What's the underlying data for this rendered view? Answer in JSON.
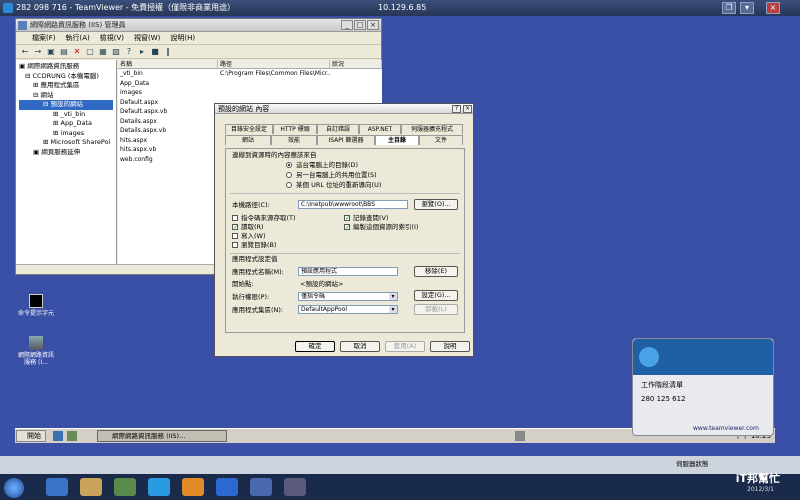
{
  "teamviewer": {
    "title": "282 098 716 - TeamViewer - 免費授權（僅限非商業用途）",
    "remote_ip": "10.129.6.85",
    "buttons": [
      "❐",
      "▾",
      "×"
    ],
    "panel_title": "工作階段清單",
    "panel_id": "280 125 612",
    "panel_link": "www.teamviewer.com",
    "sidebar_status": "伺服器狀態"
  },
  "iis": {
    "title": "網際網路資訊服務 (IIS) 管理員",
    "menu": [
      "檔案(F)",
      "執行(A)",
      "檢視(V)",
      "視窗(W)",
      "說明(H)"
    ],
    "toolbar": [
      "←",
      "→",
      "▣",
      "▤",
      "✕",
      "▢",
      "▦",
      "▧",
      "?",
      "▸",
      "■",
      "‖"
    ],
    "tree": [
      "網際網路資訊服務",
      "CCDRUNG (本機電腦)",
      "應用程式集區",
      "網站",
      "預設的網站",
      "_vti_bin",
      "App_Data",
      "images",
      "Microsoft SharePoi",
      "網頁服務延伸"
    ],
    "columns": [
      "名稱",
      "路徑",
      "狀況"
    ],
    "rows": [
      {
        "name": "_vti_bin",
        "path": "C:\\Program Files\\Common Files\\Micr..."
      },
      {
        "name": "App_Data",
        "path": ""
      },
      {
        "name": "images",
        "path": ""
      },
      {
        "name": "Default.aspx",
        "path": ""
      },
      {
        "name": "Default.aspx.vb",
        "path": ""
      },
      {
        "name": "Details.aspx",
        "path": ""
      },
      {
        "name": "Details.aspx.vb",
        "path": ""
      },
      {
        "name": "hits.aspx",
        "path": ""
      },
      {
        "name": "hits.aspx.vb",
        "path": ""
      },
      {
        "name": "web.config",
        "path": ""
      }
    ]
  },
  "desktop_icons": [
    {
      "label": "命令提示字元"
    },
    {
      "label": "網際網路資訊服務 (I..."
    }
  ],
  "dialog": {
    "title": "預設的網站 內容",
    "help": "?",
    "close": "×",
    "tabs_row1": [
      "目錄安全設定",
      "HTTP 標頭",
      "自訂錯誤",
      "ASP.NET",
      "伺服器擴充程式"
    ],
    "tabs_row2": [
      "網站",
      "效能",
      "ISAPI 篩選器",
      "主目錄",
      "文件"
    ],
    "section_source": "連線到資源時的內容應該來自",
    "radio_local": "這台電腦上的目錄(D)",
    "radio_share": "另一台電腦上的共用位置(S)",
    "radio_url": "某個 URL 位址的重新導向(U)",
    "local_path_label": "本機路徑(C):",
    "local_path_value": "C:\\Inetpub\\wwwroot\\BBS",
    "browse": "瀏覽(O)...",
    "chk_script": "指令碼來源存取(T)",
    "chk_read": "讀取(R)",
    "chk_write": "寫入(W)",
    "chk_dirbrowse": "瀏覽目錄(B)",
    "chk_log": "記錄查閱(V)",
    "chk_index": "編製這個資源的索引(I)",
    "section_app": "應用程式設定值",
    "app_name_label": "應用程式名稱(M):",
    "app_name_value": "預設應用程式",
    "remove": "移除(E)",
    "start_point_label": "開始點:",
    "start_point_value": "<預設的網站>",
    "exec_label": "執行權限(P):",
    "exec_value": "僅指令碼",
    "config": "設定(G)...",
    "pool_label": "應用程式集區(N):",
    "pool_value": "DefaultAppPool",
    "unload": "卸載(L)",
    "ok": "確定",
    "cancel": "取消",
    "apply": "套用(A)",
    "help_btn": "說明"
  },
  "taskbar": {
    "start": "開始",
    "task": "網際網路資訊服務 (IIS)...",
    "clock": "下午 10:23"
  },
  "watermark": {
    "brand": "iT邦幫忙",
    "date": "2012/3/1"
  }
}
